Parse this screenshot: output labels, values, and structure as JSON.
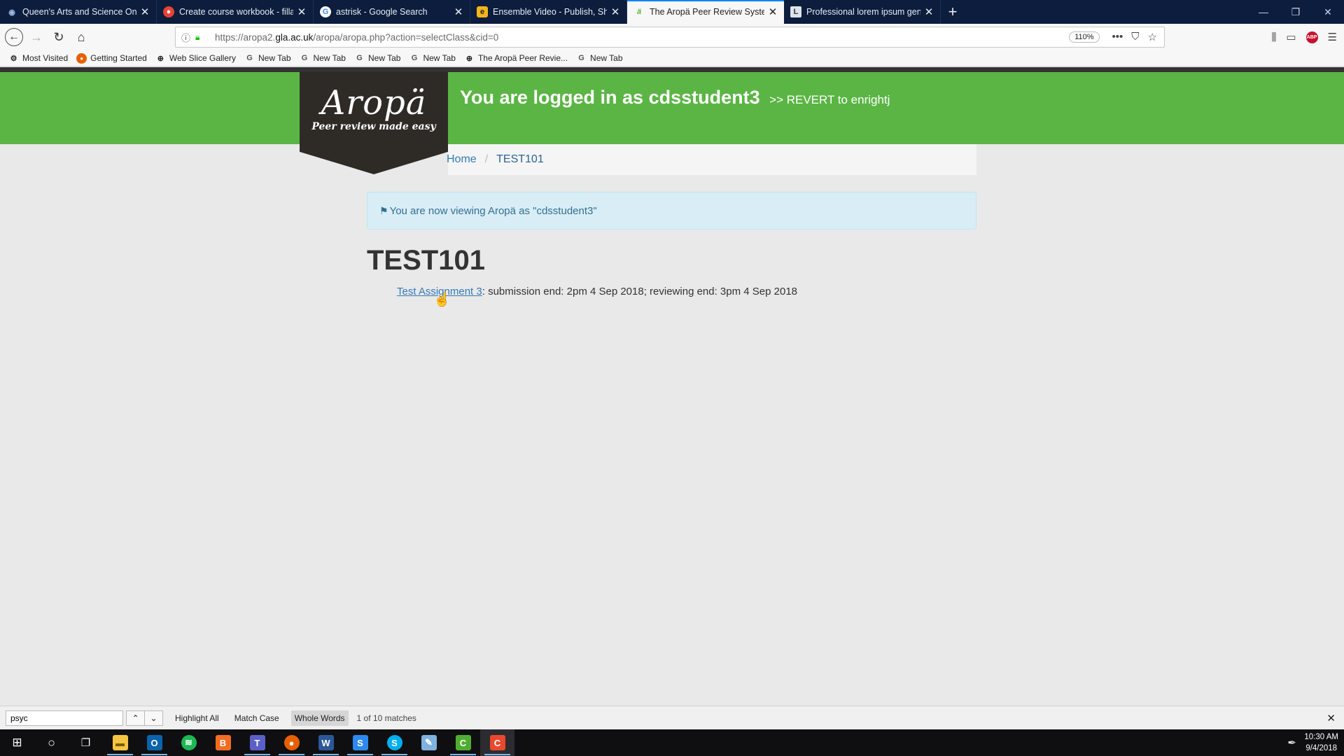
{
  "browser": {
    "tabs": [
      {
        "title": "Queen's Arts and Science Online H",
        "icon": "globe-icon",
        "color": "#1565c0",
        "active": false
      },
      {
        "title": "Create course workbook - fillab",
        "icon": "chrome-icon",
        "color": "#e94235",
        "active": false
      },
      {
        "title": "astrisk - Google Search",
        "icon": "google-icon",
        "color": "#4285f4",
        "active": false
      },
      {
        "title": "Ensemble Video - Publish, Shar",
        "icon": "ensemble-icon",
        "color": "#f3b51a",
        "active": false
      },
      {
        "title": "The Aropä Peer Review System",
        "icon": "aropa-icon",
        "color": "#5bb544",
        "active": true
      },
      {
        "title": "Professional lorem ipsum gene",
        "icon": "lorem-icon",
        "color": "#7a8797",
        "active": false
      }
    ],
    "new_tab_symbol": "+",
    "url_host": "gla.ac.uk",
    "url_prefix": "https://aropa2.",
    "url_suffix": "/aropa/aropa.php?action=selectClass&cid=0",
    "zoom": "110%",
    "bookmarks": [
      {
        "label": "Most Visited",
        "icon": "gear-icon"
      },
      {
        "label": "Getting Started",
        "icon": "firefox-icon"
      },
      {
        "label": "Web Slice Gallery",
        "icon": "globe-icon"
      },
      {
        "label": "New Tab",
        "icon": "google-icon"
      },
      {
        "label": "New Tab",
        "icon": "google-icon"
      },
      {
        "label": "New Tab",
        "icon": "google-icon"
      },
      {
        "label": "New Tab",
        "icon": "google-icon"
      },
      {
        "label": "The Aropä Peer Revie...",
        "icon": "globe-icon"
      },
      {
        "label": "New Tab",
        "icon": "google-icon"
      }
    ]
  },
  "site": {
    "logo_word": "Aropä",
    "logo_tagline": "Peer review made easy",
    "logged_in_prefix": "You are logged in as",
    "username": "cdsstudent3",
    "revert_text": ">> REVERT to enrightj",
    "header_color": "#5bb544"
  },
  "breadcrumb": {
    "home": "Home",
    "separator": "/",
    "current": "TEST101"
  },
  "alert": {
    "text": "You are now viewing Aropä as \"cdsstudent3\""
  },
  "course": {
    "title": "TEST101",
    "assignment_link": "Test Assignment 3",
    "assignment_details": ": submission end: 2pm 4 Sep 2018; reviewing end: 3pm 4 Sep 2018"
  },
  "findbar": {
    "query": "psyc",
    "highlight_all": "Highlight All",
    "match_case": "Match Case",
    "whole_words": "Whole Words",
    "status": "1 of 10 matches"
  },
  "taskbar": {
    "time": "10:30 AM",
    "date": "9/4/2018"
  }
}
